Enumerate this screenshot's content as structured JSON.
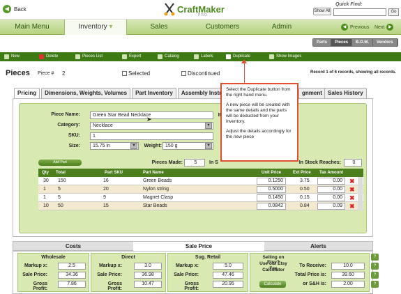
{
  "header": {
    "back_label": "Back",
    "logo_text": "CraftMaker",
    "logo_pro": "PRO",
    "show_all": "Show All",
    "quick_find_label": "Quick Find:",
    "quick_find_value": "",
    "go_label": "Go"
  },
  "nav": {
    "tabs": [
      "Main Menu",
      "Inventory",
      "Sales",
      "Customers",
      "Admin"
    ],
    "active": "Inventory",
    "previous_label": "Previous",
    "next_label": "Next"
  },
  "subnav": [
    "Parts",
    "Pieces",
    "B.O.M.",
    "Vendors"
  ],
  "toolbar": [
    "New",
    "Delete",
    "Pieces List",
    "Export",
    "Catalog",
    "Labels",
    "Duplicate",
    "Show Images"
  ],
  "pieces": {
    "title": "Pieces",
    "piece_label": "Piece #",
    "piece_number": "2",
    "selected_label": "Selected",
    "discontinued_label": "Discontinued",
    "record_text": "Record 1 of 6 records, showing all records."
  },
  "detail_tabs": [
    "Pricing",
    "Dimensions, Weights, Volumes",
    "Part Inventory",
    "Assembly Instr",
    "gnment",
    "Sales History"
  ],
  "form": {
    "piece_name_label": "Piece Name:",
    "piece_name": "Green Star Bead Necklace",
    "category_label": "Category:",
    "category": "Necklace",
    "sku_label": "SKU:",
    "sku": "1",
    "size_label": "Size:",
    "size": "15.75 in",
    "weight_label": "Weight:",
    "weight": "150 g",
    "it_label": "It",
    "pieces_made_label": "Pieces Made:",
    "pieces_made": "5",
    "in_s_label": "In S",
    "in_stock_label": "In Stock Reaches:",
    "in_stock": "0",
    "add_part": "Add Part"
  },
  "parts_table": {
    "headers": [
      "Qty",
      "Total",
      "Part SKU",
      "Part Name",
      "Unit Price",
      "Ext Price",
      "Tax Amount"
    ],
    "rows": [
      {
        "qty": "30",
        "total": "150",
        "sku": "16",
        "name": "Green Beads",
        "unit": "0.1250",
        "ext": "3.75",
        "tax": "0.00"
      },
      {
        "qty": "1",
        "total": "5",
        "sku": "20",
        "name": "Nylon string",
        "unit": "0.5000",
        "ext": "0.50",
        "tax": "0.00"
      },
      {
        "qty": "1",
        "total": "5",
        "sku": "9",
        "name": "Magnet Clasp",
        "unit": "0.1450",
        "ext": "0.15",
        "tax": "0.00"
      },
      {
        "qty": "10",
        "total": "50",
        "sku": "15",
        "name": "Star Beads",
        "unit": "0.0842",
        "ext": "0.84",
        "tax": "0.09"
      }
    ]
  },
  "bottom_tabs": [
    "Costs",
    "Sale Price",
    "Alerts"
  ],
  "pricing": {
    "wholesale": {
      "title": "Wholesale",
      "markup": "2.5",
      "sale": "34.36",
      "gross": "7.86"
    },
    "direct": {
      "title": "Direct",
      "markup": "3.0",
      "sale": "36.98",
      "gross": "10.47"
    },
    "retail": {
      "title": "Sug. Retail",
      "markup": "5.0",
      "sale": "47.46",
      "gross": "20.95"
    },
    "markup_label": "Markup x:",
    "sale_label": "Sale Price:",
    "gross_label": "Gross Profit:",
    "etsy_line1": "Selling on Etsy?",
    "etsy_line2": "Use our Etsy Fee",
    "etsy_line3": "Calculator",
    "calculate": "Calculate",
    "to_receive_label": "To Receive:",
    "to_receive": "10.0",
    "total_price_label": "Total Price is:",
    "total_price": "39.60",
    "sh_label": "or S&H is:",
    "sh": "2.00"
  },
  "popup": {
    "p1": "Select the Duplicate button from the right hand menu.",
    "p2": "A new piece will be created with the same details and the parts will be deducted from your inventory.",
    "p3": "Adjust the details accordingly for the new piece"
  },
  "colors": {
    "accent": "#4d7f1e",
    "nav_bg": "#b6d37f",
    "panel_bg": "#d8eab2",
    "callout": "#e05030"
  }
}
